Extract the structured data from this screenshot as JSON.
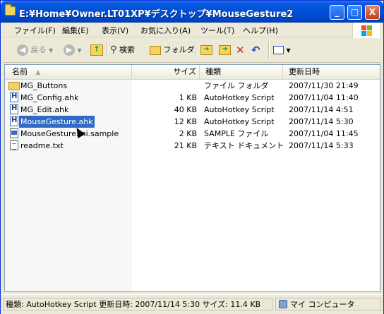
{
  "window": {
    "title": "E:¥Home¥Owner.LT01XP¥デスクトップ¥MouseGesture2",
    "min_label": "_",
    "max_label": "□",
    "close_label": "X"
  },
  "menu": [
    "ファイル(F)",
    "編集(E)",
    "表示(V)",
    "お気に入り(A)",
    "ツール(T)",
    "ヘルプ(H)"
  ],
  "toolbar": {
    "back_label": "戻る",
    "search_label": "検索",
    "folders_label": "フォルダ"
  },
  "columns": {
    "name": "名前",
    "size": "サイズ",
    "type": "種類",
    "modified": "更新日時"
  },
  "files": [
    {
      "name": "MG_Buttons",
      "size": "",
      "type": "ファイル フォルダ",
      "modified": "2007/11/30 21:49",
      "icon": "folder-icon"
    },
    {
      "name": "MG_Config.ahk",
      "size": "1 KB",
      "type": "AutoHotkey Script",
      "modified": "2007/11/04 11:40",
      "icon": "ahk-file-icon"
    },
    {
      "name": "MG_Edit.ahk",
      "size": "40 KB",
      "type": "AutoHotkey Script",
      "modified": "2007/11/14 4:51",
      "icon": "ahk-file-icon"
    },
    {
      "name": "MouseGesture.ahk",
      "size": "12 KB",
      "type": "AutoHotkey Script",
      "modified": "2007/11/14 5:30",
      "icon": "ahk-file-icon",
      "selected": true
    },
    {
      "name": "MouseGesture.ini.sample",
      "size": "2 KB",
      "type": "SAMPLE ファイル",
      "modified": "2007/11/04 11:45",
      "icon": "sample-file-icon"
    },
    {
      "name": "readme.txt",
      "size": "21 KB",
      "type": "テキスト ドキュメント",
      "modified": "2007/11/14 5:33",
      "icon": "text-file-icon"
    }
  ],
  "status": {
    "details": "種類: AutoHotkey Script 更新日時: 2007/11/14 5:30 サイズ: 11.4 KB",
    "location": "マイ コンピュータ"
  },
  "colors": {
    "titlebar": "#0052DA",
    "selection": "#316AC5",
    "chrome": "#ECE9D8"
  }
}
